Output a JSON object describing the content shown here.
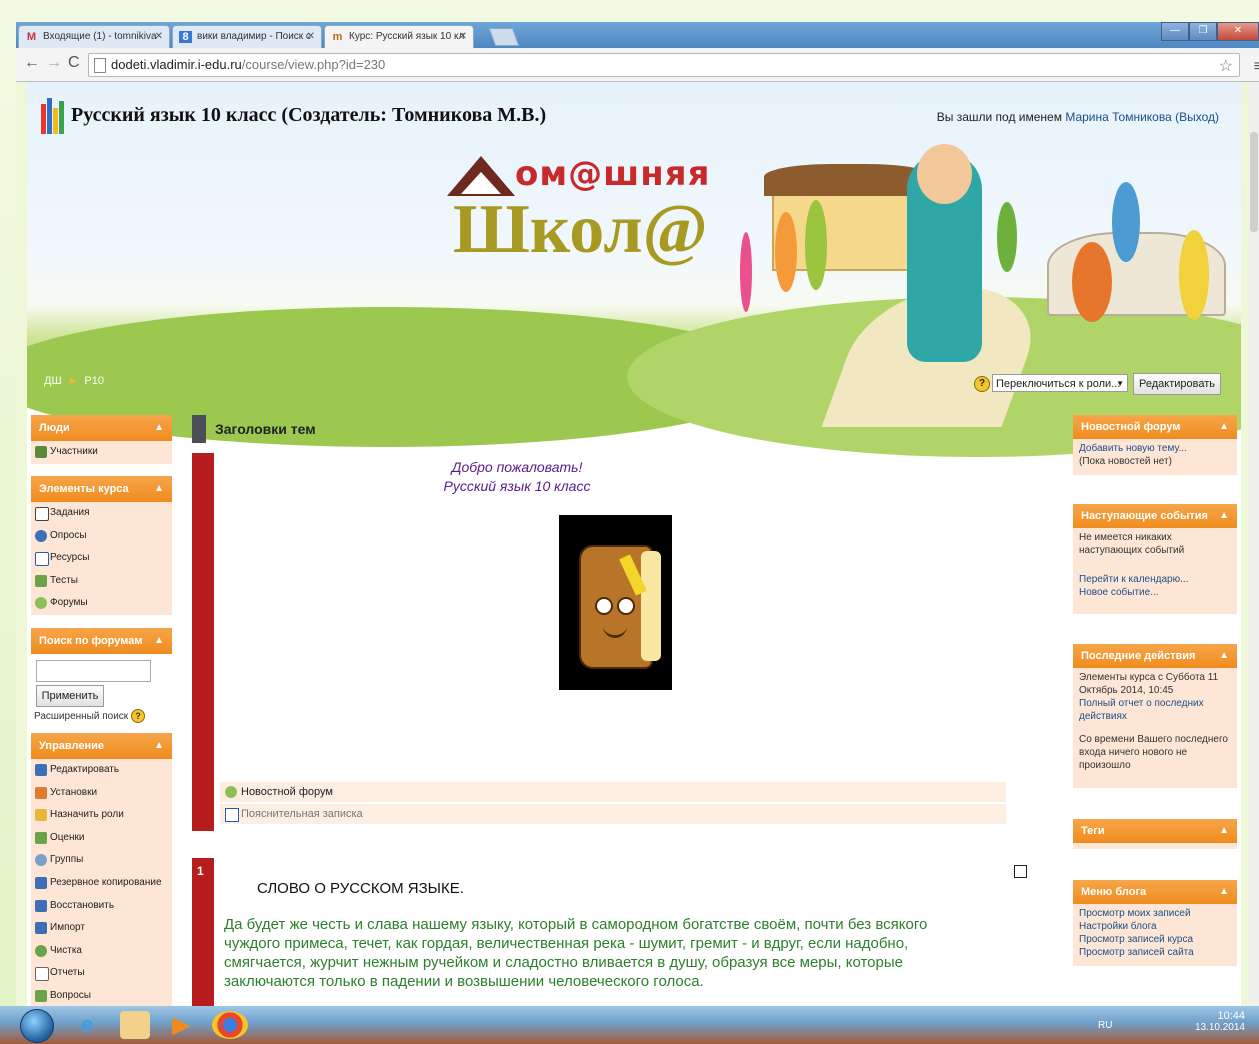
{
  "browser": {
    "tabs": [
      {
        "label": "Входящие (1) - tomnikiva",
        "icon": "gmail-icon"
      },
      {
        "label": "вики владимир - Поиск с",
        "icon": "search-engine-icon"
      },
      {
        "label": "Курс: Русский язык 10 кл",
        "icon": "moodle-icon"
      }
    ],
    "url_host": "dodeti.vladimir.i-edu.ru",
    "url_path": "/course/view.php?id=230"
  },
  "header": {
    "title": "Русский язык 10 класс (Создатель: Томникова М.В.)",
    "login_prefix": "Вы зашли под именем",
    "login_user": "Марина Томникова",
    "logout": "(Выход)",
    "brand_line1": "ом@шняя",
    "brand_line2": "Школ@",
    "breadcrumb": [
      "ДШ",
      "Р10"
    ],
    "role_select": "Переключиться к роли...",
    "edit_button": "Редактировать"
  },
  "left_blocks": {
    "people": {
      "title": "Люди",
      "items": [
        "Участники"
      ]
    },
    "elements": {
      "title": "Элементы курса",
      "items": [
        "Задания",
        "Опросы",
        "Ресурсы",
        "Тесты",
        "Форумы"
      ]
    },
    "search": {
      "title": "Поиск по форумам",
      "button": "Применить",
      "advanced": "Расширенный поиск"
    },
    "admin": {
      "title": "Управление",
      "items": [
        "Редактировать",
        "Установки",
        "Назначить роли",
        "Оценки",
        "Группы",
        "Резервное копирование",
        "Восстановить",
        "Импорт",
        "Чистка",
        "Отчеты",
        "Вопросы"
      ]
    }
  },
  "main": {
    "heading": "Заголовки тем",
    "welcome_1": "Добро пожаловать!",
    "welcome_2": "Русский язык 10 класс",
    "activities": [
      "Новостной форум",
      "Пояснительная записка"
    ],
    "section1_number": "1",
    "section1_title": "СЛОВО О РУССКОМ ЯЗЫКЕ.",
    "section1_text": "Да будет же честь и слава нашему языку, который в самородном богатстве своём, почти без всякого чуждого примеса, течет, как гордая, величественная река - шумит, гремит - и вдруг, если надобно, смягчается, журчит нежным ручейком и сладостно вливается в душу, образуя все меры, которые заключаются только в падении и возвышении человеческого голоса."
  },
  "right_blocks": {
    "news": {
      "title": "Новостной форум",
      "line1": "Добавить новую тему...",
      "line2": "(Пока новостей нет)"
    },
    "events": {
      "title": "Наступающие события",
      "line1": "Не имеется никаких наступающих событий",
      "link1": "Перейти к календарю...",
      "link2": "Новое событие..."
    },
    "recent": {
      "title": "Последние действия",
      "line1": "Элементы курса с Суббота 11 Октябрь 2014, 10:45",
      "link1": "Полный отчет о последних действиях",
      "line2": "Со времени Вашего последнего входа ничего нового не произошло"
    },
    "tags": {
      "title": "Теги"
    },
    "blog": {
      "title": "Меню блога",
      "items": [
        "Просмотр моих записей",
        "Настройки блога",
        "Просмотр записей курса",
        "Просмотр записей сайта"
      ]
    }
  },
  "taskbar": {
    "lang": "RU",
    "time": "10:44",
    "date": "13.10.2014"
  }
}
